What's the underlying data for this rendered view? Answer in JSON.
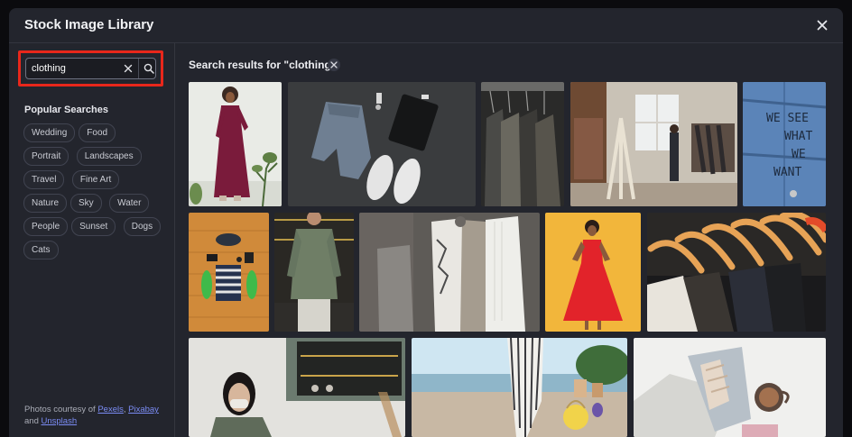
{
  "modal": {
    "title": "Stock Image Library"
  },
  "search": {
    "value": "clothing",
    "placeholder": ""
  },
  "sidebar": {
    "popular_title": "Popular Searches",
    "chips": [
      "Wedding",
      "Food",
      "Portrait",
      "Landscapes",
      "Travel",
      "Fine Art",
      "Nature",
      "Sky",
      "Water",
      "People",
      "Sunset",
      "Dogs",
      "Cats"
    ],
    "credit": {
      "prefix": "Photos courtesy of",
      "pexels": "Pexels",
      "comma": ",",
      "pixabay": "Pixabay",
      "and": "and",
      "unsplash": "Unsplash"
    }
  },
  "results": {
    "title": "Search results for \"clothing\""
  },
  "photos": [
    {
      "name": "woman-red-dress"
    },
    {
      "name": "jeans-shoes-flatlay"
    },
    {
      "name": "dark-shirts-hangers"
    },
    {
      "name": "clothing-store-interior"
    },
    {
      "name": "denim-jacket-text"
    },
    {
      "name": "beach-items-flatlay"
    },
    {
      "name": "green-jacket-man"
    },
    {
      "name": "white-shirts-rack"
    },
    {
      "name": "red-dress-yellow-bg"
    },
    {
      "name": "wooden-hangers"
    },
    {
      "name": "woman-mask-green"
    },
    {
      "name": "striped-pants-beach"
    },
    {
      "name": "jeans-coffee-flatlay"
    }
  ],
  "denim_text": [
    "WE SEE",
    "WHAT",
    "WE",
    "WANT"
  ]
}
